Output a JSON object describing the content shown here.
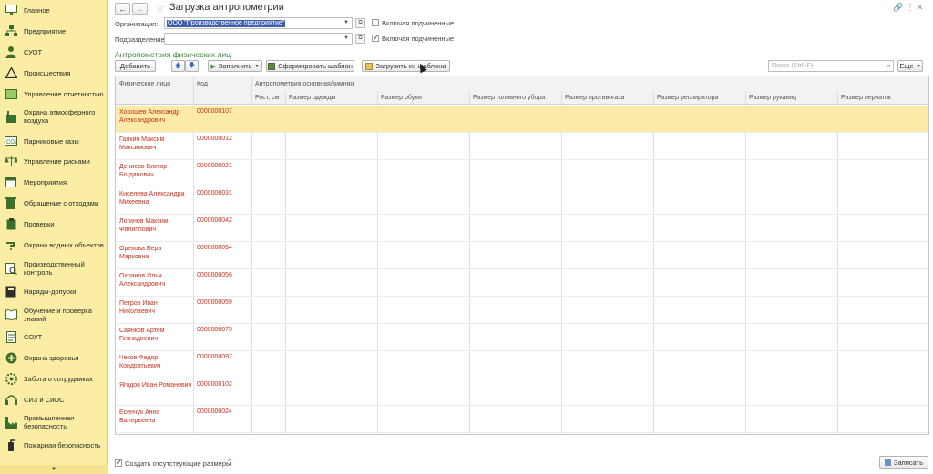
{
  "sidebar": {
    "items": [
      {
        "label": "Главное",
        "icon": "monitor-icon"
      },
      {
        "label": "Предприятие",
        "icon": "tree-icon"
      },
      {
        "label": "СУОТ",
        "icon": "person-icon"
      },
      {
        "label": "Происшествия",
        "icon": "warning-icon"
      },
      {
        "label": "Управление отчетностью",
        "icon": "folder-icon"
      },
      {
        "label": "Охрана атмосферного воздуха",
        "icon": "factory-icon"
      },
      {
        "label": "Парниковые газы",
        "icon": "co2-icon"
      },
      {
        "label": "Управление рисками",
        "icon": "balance-icon"
      },
      {
        "label": "Мероприятия",
        "icon": "calendar-icon"
      },
      {
        "label": "Обращение с отходами",
        "icon": "waste-bin-icon"
      },
      {
        "label": "Проверки",
        "icon": "clipboard-icon"
      },
      {
        "label": "Охрана водных объектов",
        "icon": "water-tap-icon"
      },
      {
        "label": "Производственный контроль",
        "icon": "magnifier-icon"
      },
      {
        "label": "Наряды-допуски",
        "icon": "permit-icon"
      },
      {
        "label": "Обучение и проверка знаний",
        "icon": "book-icon"
      },
      {
        "label": "СОУТ",
        "icon": "document-icon"
      },
      {
        "label": "Охрана здоровья",
        "icon": "health-icon"
      },
      {
        "label": "Забота о сотрудниках",
        "icon": "gear-person-icon"
      },
      {
        "label": "СИЗ и СиОС",
        "icon": "headset-icon"
      },
      {
        "label": "Промышленная безопасность",
        "icon": "industry-icon"
      },
      {
        "label": "Пожарная безопасность",
        "icon": "fire-extinguisher-icon"
      }
    ]
  },
  "header": {
    "title": "Загрузка антропометрии",
    "back": "←",
    "forward": "→"
  },
  "filters": {
    "org_label": "Организация:",
    "org_value": "ООО \"Производственное предприятие\"",
    "org_checkbox_label": "Включая подчиненные",
    "org_checkbox_checked": false,
    "dept_label": "Подразделение:",
    "dept_value": "",
    "dept_checkbox_label": "Включая подчиненные",
    "dept_checkbox_checked": true
  },
  "section_title": "Антропометрия физических лиц",
  "toolbar": {
    "add": "Добавить",
    "fill": "Заполнить",
    "make_template": "Сформировать шаблон",
    "load_template": "Загрузить из шаблона",
    "search_placeholder": "Поиск (Ctrl+F)",
    "more": "Еще"
  },
  "table": {
    "col_person": "Физическое лицо",
    "col_code": "Код",
    "group_header": "Антропометрия основная/зимняя",
    "sub_cols": [
      "Рост, см",
      "Размер одежды",
      "Размер обуви",
      "Размер головного убора",
      "Размер противогаза",
      "Размер респиратора",
      "Размер рукавиц",
      "Размер перчаток"
    ],
    "rows": [
      {
        "name": "Хорошев Александр Александрович",
        "code": "0000000107"
      },
      {
        "name": "Галкин Максим Максимович",
        "code": "0000000012"
      },
      {
        "name": "Денисов Виктор Богданович",
        "code": "0000000021"
      },
      {
        "name": "Киселева Александра Михеевна",
        "code": "0000000031"
      },
      {
        "name": "Логинов Максим Филиппович",
        "code": "0000000042"
      },
      {
        "name": "Орехова Вера Марковна",
        "code": "0000000054"
      },
      {
        "name": "Охранов Илья Александрович",
        "code": "0000000056"
      },
      {
        "name": "Петров Иван Николаевич",
        "code": "0000000059"
      },
      {
        "name": "Саянков Артем Геннадиевич",
        "code": "0000000075"
      },
      {
        "name": "Чехов Федор Кондратьевич",
        "code": "0000000097"
      },
      {
        "name": "Ягодов Иван Романович",
        "code": "0000000102"
      },
      {
        "name": "Есенчук Анна Валерьевна",
        "code": "0000000024"
      }
    ]
  },
  "footer": {
    "create_missing_label": "Создать отсутствующие размеры",
    "create_missing_checked": true,
    "help": "?",
    "save": "Записать"
  },
  "colors": {
    "sidebar_bg": "#fbeda4",
    "selected_row": "#fbeaa8",
    "link_red": "#c8321e",
    "section_green": "#3d8b3d"
  }
}
